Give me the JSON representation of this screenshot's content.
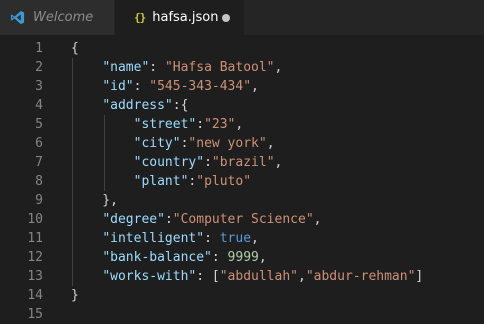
{
  "tabs": [
    {
      "label": "Welcome",
      "icon": "vscode-logo-icon",
      "active": false
    },
    {
      "label": "hafsa.json",
      "icon": "json-braces-icon",
      "glyph": "{}",
      "active": true,
      "unsaved": true
    }
  ],
  "editor": {
    "language": "json",
    "lines": [
      {
        "num": "1",
        "tokens": [
          {
            "t": "p",
            "v": "{"
          }
        ]
      },
      {
        "num": "2",
        "tokens": [
          {
            "t": "p",
            "v": "    "
          },
          {
            "t": "k",
            "v": "\"name\""
          },
          {
            "t": "p",
            "v": ": "
          },
          {
            "t": "s",
            "v": "\"Hafsa Batool\""
          },
          {
            "t": "p",
            "v": ","
          }
        ]
      },
      {
        "num": "3",
        "tokens": [
          {
            "t": "p",
            "v": "    "
          },
          {
            "t": "k",
            "v": "\"id\""
          },
          {
            "t": "p",
            "v": ": "
          },
          {
            "t": "s",
            "v": "\"545-343-434\""
          },
          {
            "t": "p",
            "v": ","
          }
        ]
      },
      {
        "num": "4",
        "tokens": [
          {
            "t": "p",
            "v": "    "
          },
          {
            "t": "k",
            "v": "\"address\""
          },
          {
            "t": "p",
            "v": ":{"
          }
        ]
      },
      {
        "num": "5",
        "tokens": [
          {
            "t": "p",
            "v": "        "
          },
          {
            "t": "k",
            "v": "\"street\""
          },
          {
            "t": "p",
            "v": ":"
          },
          {
            "t": "s",
            "v": "\"23\""
          },
          {
            "t": "p",
            "v": ","
          }
        ]
      },
      {
        "num": "6",
        "tokens": [
          {
            "t": "p",
            "v": "        "
          },
          {
            "t": "k",
            "v": "\"city\""
          },
          {
            "t": "p",
            "v": ":"
          },
          {
            "t": "s",
            "v": "\"new york\""
          },
          {
            "t": "p",
            "v": ","
          }
        ]
      },
      {
        "num": "7",
        "tokens": [
          {
            "t": "p",
            "v": "        "
          },
          {
            "t": "k",
            "v": "\"country\""
          },
          {
            "t": "p",
            "v": ":"
          },
          {
            "t": "s",
            "v": "\"brazil\""
          },
          {
            "t": "p",
            "v": ","
          }
        ]
      },
      {
        "num": "8",
        "tokens": [
          {
            "t": "p",
            "v": "        "
          },
          {
            "t": "k",
            "v": "\"plant\""
          },
          {
            "t": "p",
            "v": ":"
          },
          {
            "t": "s",
            "v": "\"pluto\""
          }
        ]
      },
      {
        "num": "9",
        "tokens": [
          {
            "t": "p",
            "v": "    },"
          }
        ]
      },
      {
        "num": "10",
        "tokens": [
          {
            "t": "p",
            "v": "    "
          },
          {
            "t": "k",
            "v": "\"degree\""
          },
          {
            "t": "p",
            "v": ":"
          },
          {
            "t": "s",
            "v": "\"Computer Science\""
          },
          {
            "t": "p",
            "v": ","
          }
        ]
      },
      {
        "num": "11",
        "tokens": [
          {
            "t": "p",
            "v": "    "
          },
          {
            "t": "k",
            "v": "\"intelligent\""
          },
          {
            "t": "p",
            "v": ": "
          },
          {
            "t": "b",
            "v": "true"
          },
          {
            "t": "p",
            "v": ","
          }
        ]
      },
      {
        "num": "12",
        "tokens": [
          {
            "t": "p",
            "v": "    "
          },
          {
            "t": "k",
            "v": "\"bank-balance\""
          },
          {
            "t": "p",
            "v": ": "
          },
          {
            "t": "n",
            "v": "9999"
          },
          {
            "t": "p",
            "v": ","
          }
        ]
      },
      {
        "num": "13",
        "tokens": [
          {
            "t": "p",
            "v": "    "
          },
          {
            "t": "k",
            "v": "\"works-with\""
          },
          {
            "t": "p",
            "v": ": ["
          },
          {
            "t": "s",
            "v": "\"abdullah\""
          },
          {
            "t": "p",
            "v": ","
          },
          {
            "t": "s",
            "v": "\"abdur-rehman\""
          },
          {
            "t": "p",
            "v": "]"
          }
        ]
      },
      {
        "num": "14",
        "tokens": [
          {
            "t": "p",
            "v": "}"
          }
        ]
      },
      {
        "num": "15",
        "tokens": []
      }
    ]
  },
  "colors": {
    "background": "#1e1e1e",
    "tabbar": "#252526",
    "key": "#9cdcfe",
    "string": "#ce9178",
    "number": "#b5cea8",
    "boolean": "#569cd6",
    "line_number": "#858585"
  }
}
